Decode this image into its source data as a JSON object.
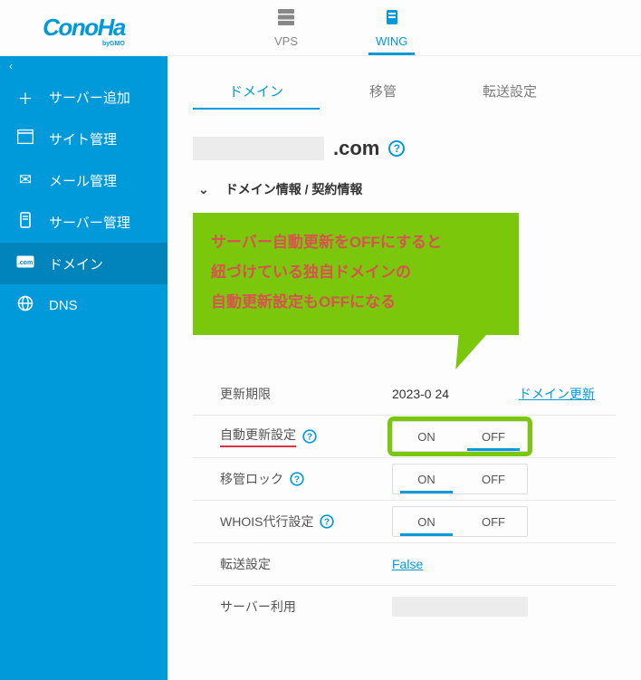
{
  "brand": {
    "name": "ConoHa",
    "byline": "byGMO"
  },
  "topTabs": [
    {
      "label": "VPS",
      "active": false
    },
    {
      "label": "WING",
      "active": true
    }
  ],
  "sidebar": {
    "items": [
      {
        "label": "サーバー追加",
        "icon": "plus"
      },
      {
        "label": "サイト管理",
        "icon": "window"
      },
      {
        "label": "メール管理",
        "icon": "mail"
      },
      {
        "label": "サーバー管理",
        "icon": "server"
      },
      {
        "label": "ドメイン",
        "icon": "domain",
        "active": true
      },
      {
        "label": "DNS",
        "icon": "globe"
      }
    ]
  },
  "subTabs": [
    {
      "label": "ドメイン",
      "active": true
    },
    {
      "label": "移管"
    },
    {
      "label": "転送設定"
    }
  ],
  "domain": {
    "suffix": ".com"
  },
  "section": {
    "title": "ドメイン情報 / 契約情報"
  },
  "callout": {
    "line1": "サーバー自動更新をOFFにすると",
    "line2": "紐づけている独自ドメインの",
    "line3": "自動更新設定もOFFになる"
  },
  "rows": {
    "expiry": {
      "label": "更新期限",
      "value": "2023-0   24",
      "link": "ドメイン更新"
    },
    "autoRenew": {
      "label": "自動更新設定",
      "on": "ON",
      "off": "OFF",
      "selected": "OFF",
      "hl": true
    },
    "transferLock": {
      "label": "移管ロック",
      "on": "ON",
      "off": "OFF",
      "selected": "ON"
    },
    "whois": {
      "label": "WHOIS代行設定",
      "on": "ON",
      "off": "OFF",
      "selected": "ON"
    },
    "forward": {
      "label": "転送設定",
      "value": "False"
    },
    "serverUse": {
      "label": "サーバー利用"
    }
  }
}
